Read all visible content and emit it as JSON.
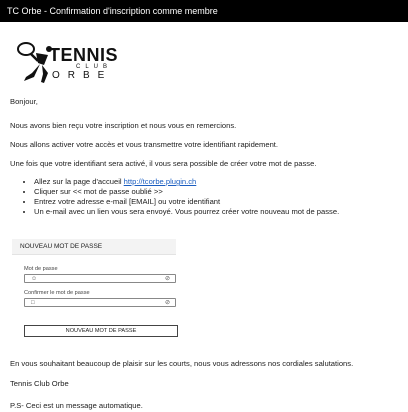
{
  "window": {
    "title": "TC Orbe - Confirmation d'inscription comme membre"
  },
  "logo": {
    "word1": "TENNIS",
    "word2": "CLUB",
    "word3": "ORBE"
  },
  "body": {
    "greeting": "Bonjour,",
    "line1": "Nous avons bien reçu votre inscription et nous vous en remercions.",
    "line2": "Nous allons activer votre accès et vous transmettre votre identifiant rapidement.",
    "line3": "Une fois que votre identifiant sera activé, il vous sera possible de créer votre mot de passe.",
    "bullets": {
      "b1_prefix": "Allez sur la page d'accueil ",
      "b1_link": "http://tcorbe.plugin.ch",
      "b2": "Cliquer sur << mot de passe oublié >>",
      "b3": "Entrez votre adresse e-mail  [EMAIL] ou votre identifiant",
      "b4": "Un e-mail avec un lien vous sera envoyé. Vous pourrez créer votre nouveau mot de passe."
    }
  },
  "form": {
    "header": "NOUVEAU MOT DE PASSE",
    "password_label": "Mot de passe",
    "confirm_label": "Confirmer le mot de passe",
    "submit_label": "NOUVEAU MOT DE PASSE"
  },
  "footer": {
    "salutation": "En vous souhaitant beaucoup de plaisir sur les courts, nous vous adressons nos cordiales salutations.",
    "signature": "Tennis Club Orbe",
    "ps": "P.S- Ceci est un message automatique."
  }
}
